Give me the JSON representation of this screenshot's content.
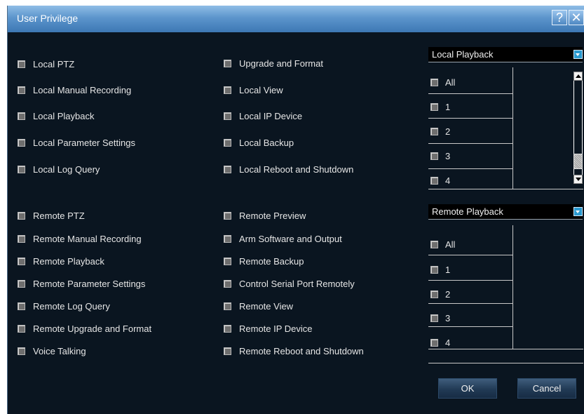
{
  "dialog": {
    "title": "User Privilege",
    "help_glyph": "?",
    "close_glyph": "✕"
  },
  "local_privileges": {
    "col1": [
      "Local PTZ",
      "Local Manual Recording",
      "Local Playback",
      "Local Parameter Settings",
      "Local Log Query"
    ],
    "col2": [
      "Upgrade and Format",
      "Local View",
      "Local IP Device",
      "Local Backup",
      "Local Reboot and Shutdown"
    ]
  },
  "remote_privileges": {
    "col1": [
      "Remote PTZ",
      "Remote Manual Recording",
      "Remote Playback",
      "Remote Parameter Settings",
      "Remote Log Query",
      "Remote Upgrade and Format",
      "Voice Talking"
    ],
    "col2": [
      "Remote Preview",
      "Arm Software and Output",
      "Remote Backup",
      "Control Serial Port Remotely",
      "Remote View",
      "Remote IP Device",
      "Remote Reboot and Shutdown"
    ]
  },
  "local_playback_panel": {
    "selected": "Local Playback",
    "channels": [
      "All",
      "1",
      "2",
      "3",
      "4"
    ]
  },
  "remote_playback_panel": {
    "selected": "Remote Playback",
    "channels": [
      "All",
      "1",
      "2",
      "3",
      "4"
    ]
  },
  "buttons": {
    "ok": "OK",
    "cancel": "Cancel"
  },
  "icons": {
    "checkbox": "checkbox-icon",
    "help": "help-icon",
    "close": "close-icon",
    "dropdown": "dropdown-arrow-icon",
    "scroll_up": "scroll-up-icon",
    "scroll_down": "scroll-down-icon"
  }
}
